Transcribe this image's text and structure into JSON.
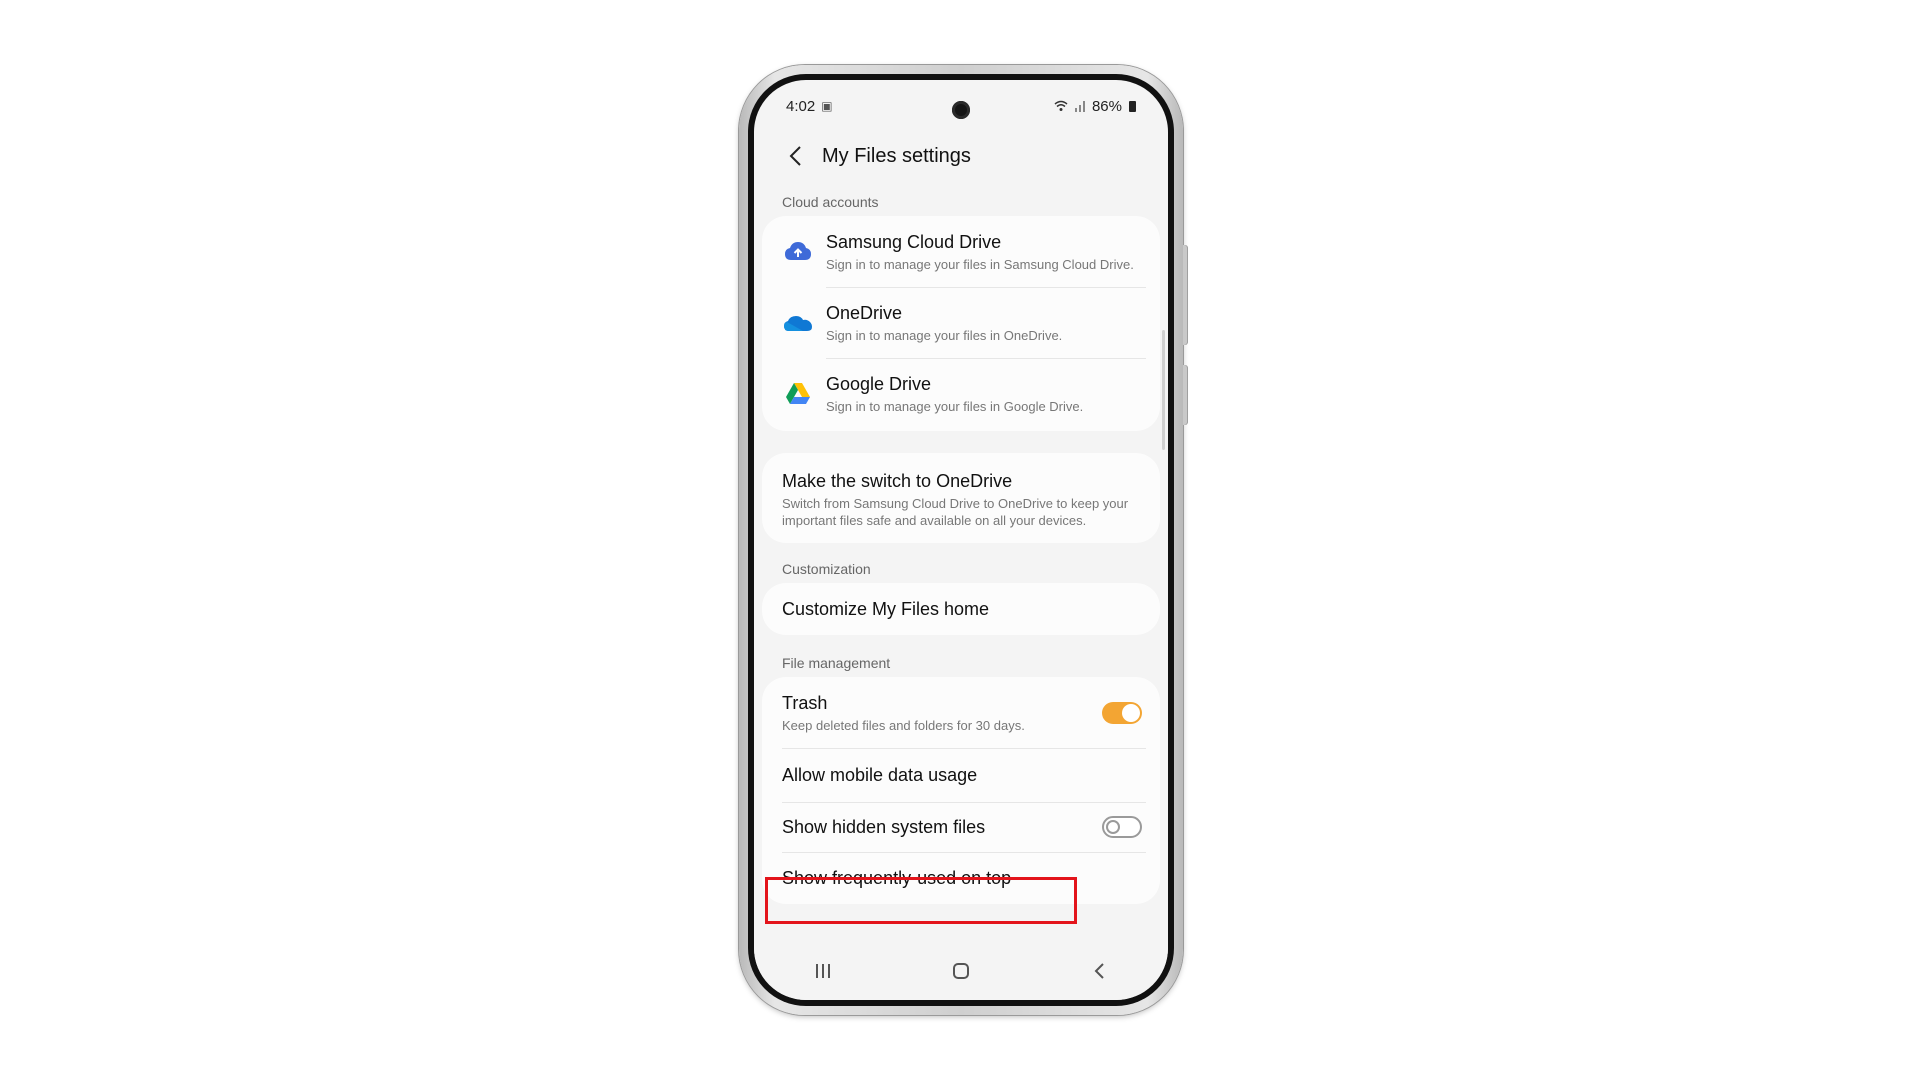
{
  "status_bar": {
    "time": "4:02",
    "battery": "86%"
  },
  "header": {
    "title": "My Files settings"
  },
  "cloud": {
    "section_title": "Cloud accounts",
    "items": [
      {
        "title": "Samsung Cloud Drive",
        "subtitle": "Sign in to manage your files in Samsung Cloud Drive.",
        "icon": "samsung-cloud-icon"
      },
      {
        "title": "OneDrive",
        "subtitle": "Sign in to manage your files in OneDrive.",
        "icon": "onedrive-icon"
      },
      {
        "title": "Google Drive",
        "subtitle": "Sign in to manage your files in Google Drive.",
        "icon": "google-drive-icon"
      }
    ]
  },
  "promo": {
    "title": "Make the switch to OneDrive",
    "subtitle": "Switch from Samsung Cloud Drive to OneDrive to keep your important files safe and available on all your devices."
  },
  "customization": {
    "section_title": "Customization",
    "items": [
      {
        "title": "Customize My Files home"
      }
    ]
  },
  "file_management": {
    "section_title": "File management",
    "items": [
      {
        "title": "Trash",
        "subtitle": "Keep deleted files and folders for 30 days.",
        "toggle": true
      },
      {
        "title": "Allow mobile data usage"
      },
      {
        "title": "Show hidden system files",
        "toggle": false
      },
      {
        "title": "Show frequently-used on top"
      }
    ]
  },
  "colors": {
    "toggle_on": "#f3a533",
    "highlight": "#e3141b"
  }
}
